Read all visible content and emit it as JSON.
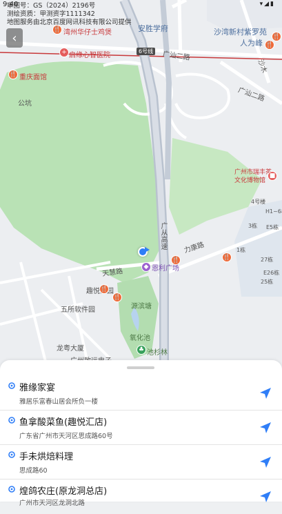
{
  "status": {
    "time": "9:40",
    "icons": "▾◢▮"
  },
  "license": [
    "审图号：GS（2024）2196号",
    "测绘资质：甲测资字1111342",
    "地图服务由北京百度网讯科技有限公司提供"
  ],
  "map_labels": {
    "anshengxuefu": "安胜学府",
    "shawan": "沙湾新村紫罗苑",
    "renwei": "人为峰",
    "guangshan2_top": "广汕二路",
    "guangshan2_right": "广汕二路",
    "shamu": "沙木",
    "wanzhou": "湾州华仔士鸡煲",
    "qiyuan": "启缘心智医院",
    "shield6": "6号线",
    "chongqing": "重庆面馆",
    "gongce": "公坑",
    "guangzhou_ruifeng": "广州市瑞丰茶文化博物馆",
    "building4": "4号楼",
    "h1": "H1~6栋",
    "b3": "3栋",
    "e5": "E5栋",
    "b1": "1栋",
    "b27": "27栋",
    "e26": "E26栋",
    "b25": "25栋",
    "guangcong": "广从高速",
    "likang": "力康路",
    "tianhui": "天慧路",
    "enli": "恩利广场",
    "quyue": "趣悦汇园",
    "yuanhu": "源滨塘",
    "wusuo": "五所软件园",
    "yanghua": "氧化池",
    "chishan": "池杉林",
    "longyue": "龙粤大厦",
    "guangzhou_zhi": "广州致远电子"
  },
  "results": [
    {
      "name": "雅缘家宴",
      "address": "雅居乐富春山居会所负一楼"
    },
    {
      "name": "鱼拿酸菜鱼(趣悦汇店)",
      "address": "广东省广州市天河区思成路60号"
    },
    {
      "name": "手未烘焙料理",
      "address": "思成路60"
    },
    {
      "name": "煌鸽农庄(原龙洞总店)",
      "address": "广州市天河区龙洞北路"
    }
  ],
  "colors": {
    "park": "#b9e2b5",
    "road": "#ffffff",
    "highway": "#b9c2cf",
    "metro_line": "#c8383a",
    "accent": "#2f7ef7"
  }
}
